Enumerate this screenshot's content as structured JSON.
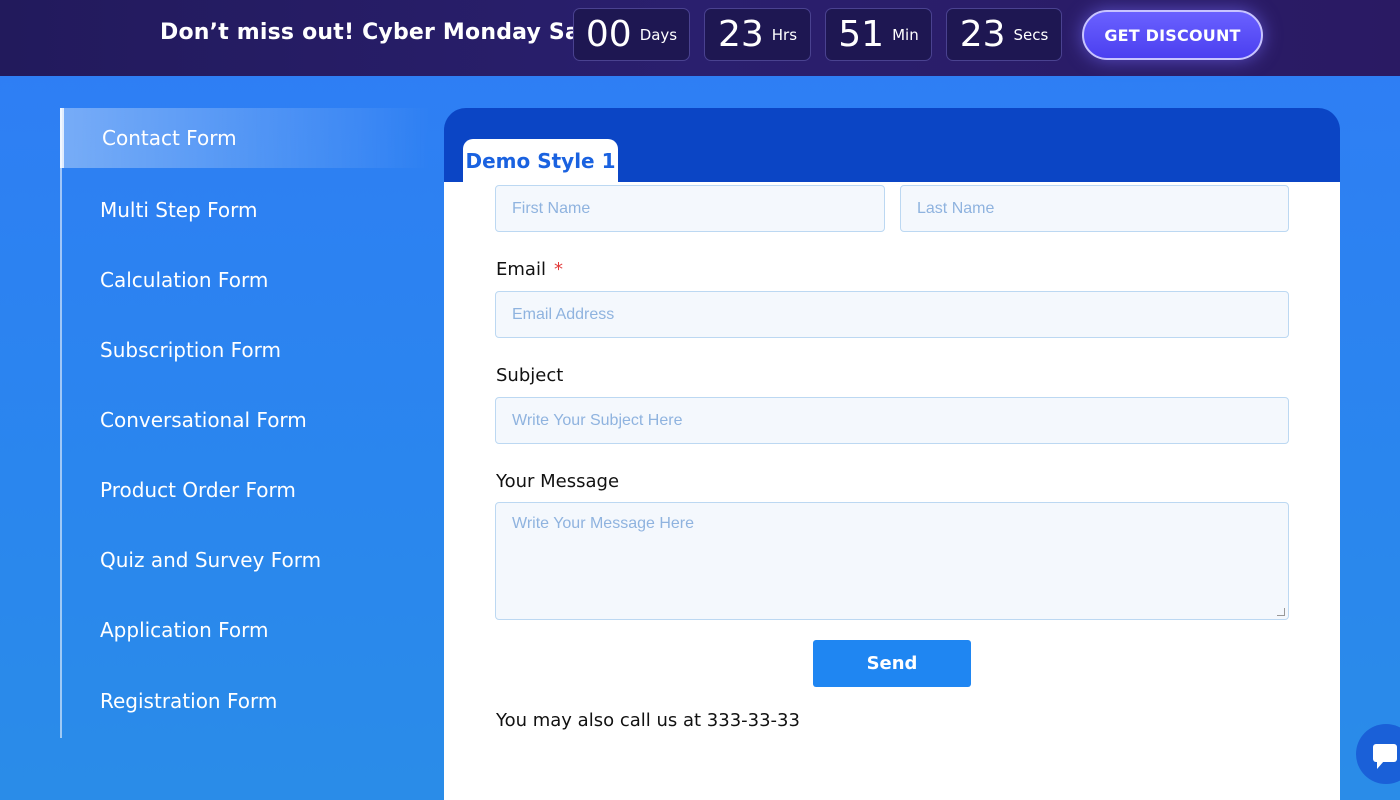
{
  "promo": {
    "message": "Don’t miss out! Cyber Monday Sale",
    "countdown": [
      {
        "value": "00",
        "unit": "Days"
      },
      {
        "value": "23",
        "unit": "Hrs"
      },
      {
        "value": "51",
        "unit": "Min"
      },
      {
        "value": "23",
        "unit": "Secs"
      }
    ],
    "cta_label": "GET DISCOUNT"
  },
  "sidebar": {
    "items": [
      {
        "label": "Contact Form",
        "active": true
      },
      {
        "label": "Multi Step Form"
      },
      {
        "label": "Calculation Form"
      },
      {
        "label": "Subscription Form"
      },
      {
        "label": "Conversational Form"
      },
      {
        "label": "Product Order Form"
      },
      {
        "label": "Quiz and Survey Form"
      },
      {
        "label": "Application Form"
      },
      {
        "label": "Registration Form"
      }
    ]
  },
  "form": {
    "tab_label": "Demo Style 1",
    "first_name_placeholder": "First Name",
    "last_name_placeholder": "Last Name",
    "email_label": "Email",
    "required_mark": "*",
    "email_placeholder": "Email Address",
    "subject_label": "Subject",
    "subject_placeholder": "Write Your Subject Here",
    "message_label": "Your Message",
    "message_placeholder": "Write Your Message Here",
    "send_label": "Send",
    "call_text": "You may also call us at 333-33-33"
  },
  "colors": {
    "accent": "#1f86f2",
    "panel_header": "#0b45c5",
    "promo_bg": "#221a5c",
    "required": "#e23b3b"
  }
}
